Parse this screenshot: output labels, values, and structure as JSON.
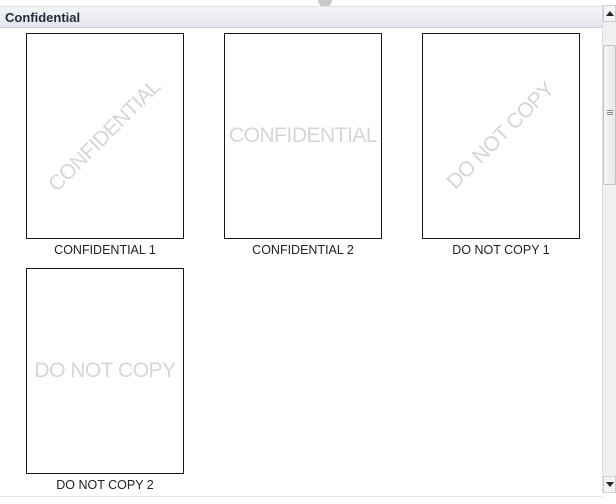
{
  "gallery": {
    "section_title": "Confidential",
    "items": [
      {
        "label": "CONFIDENTIAL 1",
        "watermark": "CONFIDENTIAL",
        "orientation": "diagonal"
      },
      {
        "label": "CONFIDENTIAL 2",
        "watermark": "CONFIDENTIAL",
        "orientation": "horizontal"
      },
      {
        "label": "DO NOT COPY 1",
        "watermark": "DO NOT COPY",
        "orientation": "diagonal"
      },
      {
        "label": "DO NOT COPY 2",
        "watermark": "DO NOT COPY",
        "orientation": "horizontal"
      }
    ]
  },
  "scrollbar": {
    "position_fraction": 0.0
  }
}
